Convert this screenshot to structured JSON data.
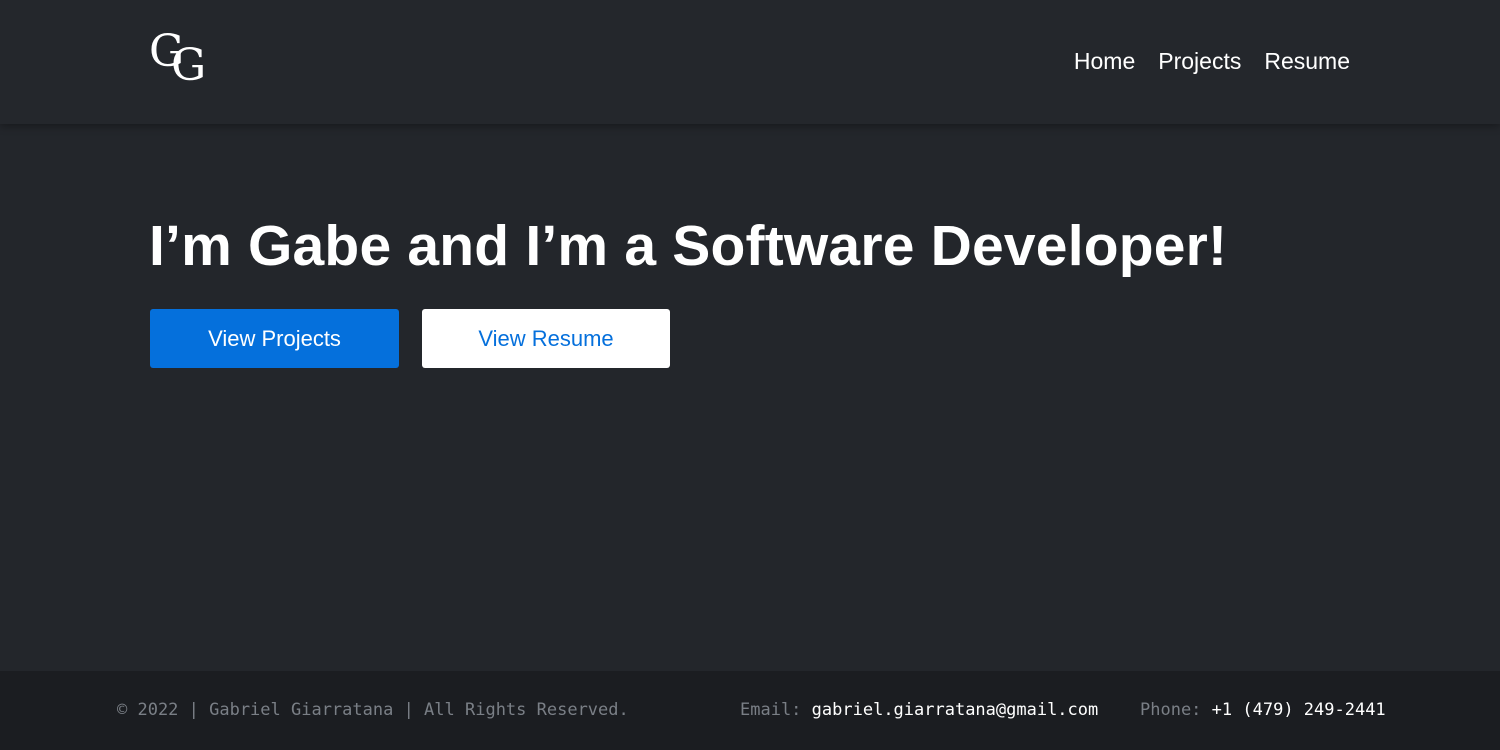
{
  "header": {
    "logo": {
      "letter_1": "G",
      "letter_2": "G"
    },
    "nav": [
      {
        "label": "Home"
      },
      {
        "label": "Projects"
      },
      {
        "label": "Resume"
      }
    ]
  },
  "hero": {
    "headline": "I’m Gabe and I’m a Software Developer!",
    "primary_button": "View Projects",
    "secondary_button": "View Resume"
  },
  "footer": {
    "copyright": "© 2022 | Gabriel Giarratana | All Rights Reserved.",
    "email_label": "Email:",
    "email_value": "gabriel.giarratana@gmail.com",
    "phone_label": "Phone:",
    "phone_value": "+1 (479) 249-2441"
  },
  "colors": {
    "background": "#23262b",
    "header_bg": "#24272c",
    "footer_bg": "#1b1d21",
    "accent": "#0570dc",
    "muted_text": "#7a7f86",
    "text": "#ffffff"
  }
}
